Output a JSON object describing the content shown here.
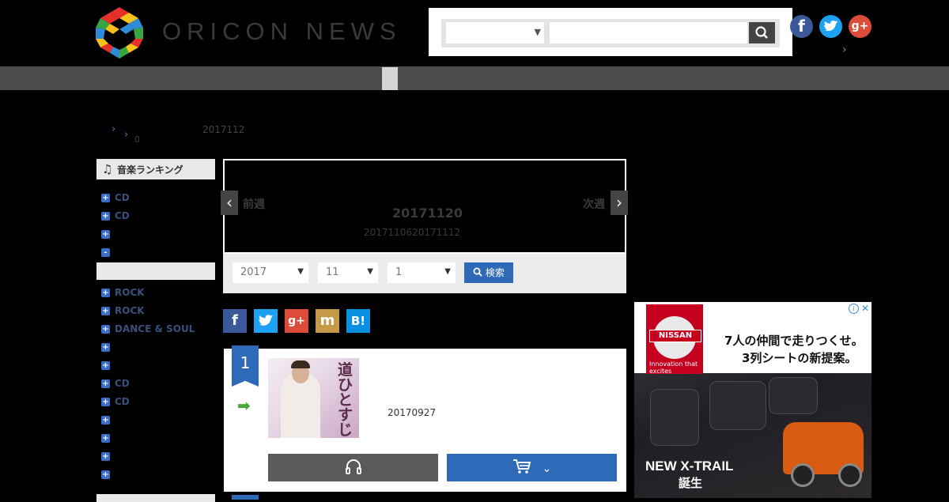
{
  "header": {
    "brand": "ORICON NEWS",
    "search": {
      "category_value": "",
      "keyword_value": "",
      "button_icon": "search-icon"
    },
    "social": {
      "facebook": "f",
      "twitter": "t",
      "googleplus": "g+"
    },
    "chevron": "›"
  },
  "breadcrumb": {
    "sep1": "›",
    "sep2": "›",
    "count": "0",
    "date": "2017112"
  },
  "sidebar": {
    "title": "音楽ランキング",
    "items": [
      {
        "sign": "+",
        "label": "CD"
      },
      {
        "sign": "+",
        "label": "CD"
      },
      {
        "sign": "+",
        "label": ""
      },
      {
        "sign": "-",
        "label": ""
      }
    ],
    "items2": [
      {
        "sign": "+",
        "label": "ROCK"
      },
      {
        "sign": "+",
        "label": "ROCK"
      },
      {
        "sign": "+",
        "label": "DANCE & SOUL"
      },
      {
        "sign": "+",
        "label": ""
      },
      {
        "sign": "+",
        "label": ""
      },
      {
        "sign": "+",
        "label": "CD"
      },
      {
        "sign": "+",
        "label": "CD"
      },
      {
        "sign": "+",
        "label": ""
      },
      {
        "sign": "+",
        "label": ""
      },
      {
        "sign": "+",
        "label": ""
      },
      {
        "sign": "+",
        "label": ""
      }
    ]
  },
  "week": {
    "prev_label": "前週",
    "next_label": "次週",
    "prev_arrow": "‹",
    "next_arrow": "›",
    "date": "20171120",
    "range": "2017110620171112"
  },
  "filter": {
    "year": "2017",
    "month": "11",
    "week": "1",
    "arrow": "▼",
    "search_label": "検索"
  },
  "share": {
    "facebook": "f",
    "twitter": "t",
    "googleplus": "g+",
    "mixi": "m",
    "hatena": "B!"
  },
  "ranking": [
    {
      "rank": "1",
      "trend": "➡",
      "jacket_title": "道ひとすじ",
      "release_date": "20170927",
      "listen_icon": "headphones-icon",
      "buy_icon": "cart-icon",
      "buy_chevron": "⌄"
    }
  ],
  "ad": {
    "brand": "NISSAN",
    "tagline": "Innovation that excites",
    "copy1": "7人の仲間で走りつくせ。",
    "copy2": "3列シートの新提案。",
    "headline": "NEW X-TRAIL",
    "subline": "誕生",
    "adchoice_i": "i",
    "adchoice_x": "✕"
  }
}
